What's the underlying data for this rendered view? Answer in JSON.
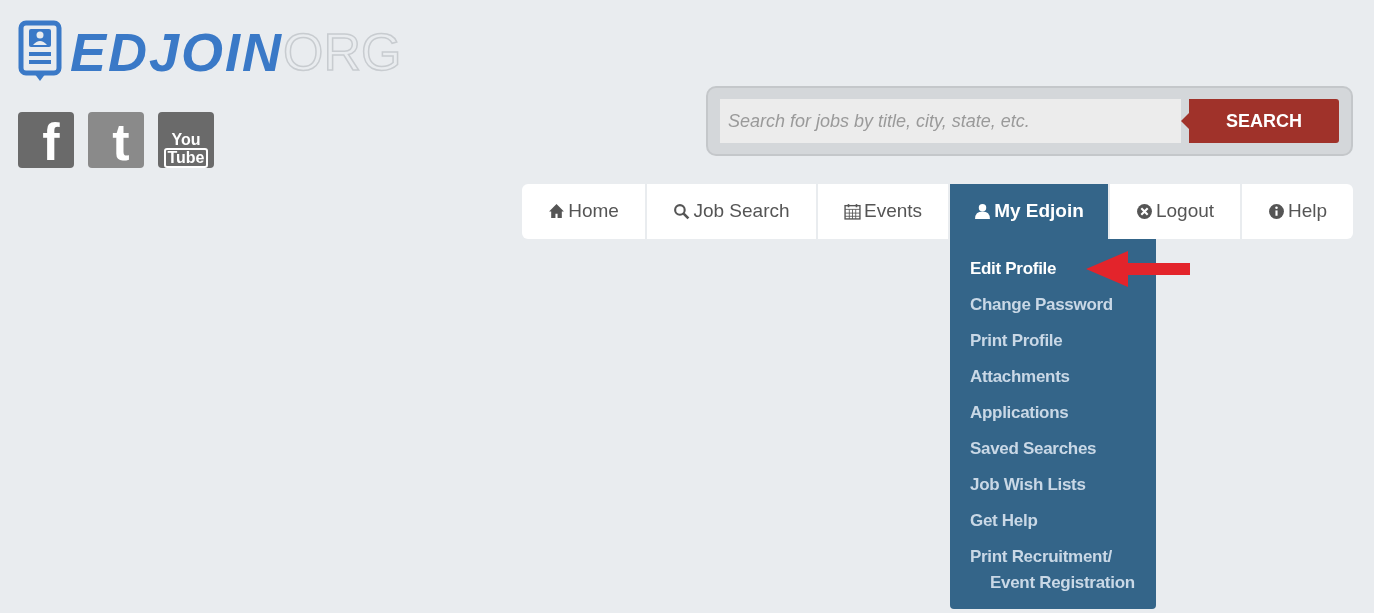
{
  "logo": {
    "name": "EDJOIN",
    "suffix": "ORG"
  },
  "social": [
    {
      "kind": "facebook",
      "label": "f"
    },
    {
      "kind": "twitter",
      "label": "t"
    },
    {
      "kind": "youtube",
      "label": "You",
      "label2": "Tube"
    }
  ],
  "search": {
    "placeholder": "Search for jobs by title, city, state, etc.",
    "button": "SEARCH"
  },
  "nav": [
    {
      "kind": "home",
      "label": "Home",
      "selected": false
    },
    {
      "kind": "search",
      "label": "Job Search",
      "selected": false
    },
    {
      "kind": "calendar",
      "label": "Events",
      "selected": false
    },
    {
      "kind": "user",
      "label": "My Edjoin",
      "selected": true
    },
    {
      "kind": "close",
      "label": "Logout",
      "selected": false
    },
    {
      "kind": "info",
      "label": "Help",
      "selected": false
    }
  ],
  "dropdown": [
    {
      "lines": [
        "Edit Profile"
      ],
      "selected": true
    },
    {
      "lines": [
        "Change Password"
      ],
      "selected": false
    },
    {
      "lines": [
        "Print Profile"
      ],
      "selected": false
    },
    {
      "lines": [
        "Attachments"
      ],
      "selected": false
    },
    {
      "lines": [
        "Applications"
      ],
      "selected": false
    },
    {
      "lines": [
        "Saved Searches"
      ],
      "selected": false
    },
    {
      "lines": [
        "Job Wish Lists"
      ],
      "selected": false
    },
    {
      "lines": [
        "Get Help"
      ],
      "selected": false
    },
    {
      "lines": [
        "Print Recruitment/",
        "Event Registration"
      ],
      "selected": false
    }
  ]
}
